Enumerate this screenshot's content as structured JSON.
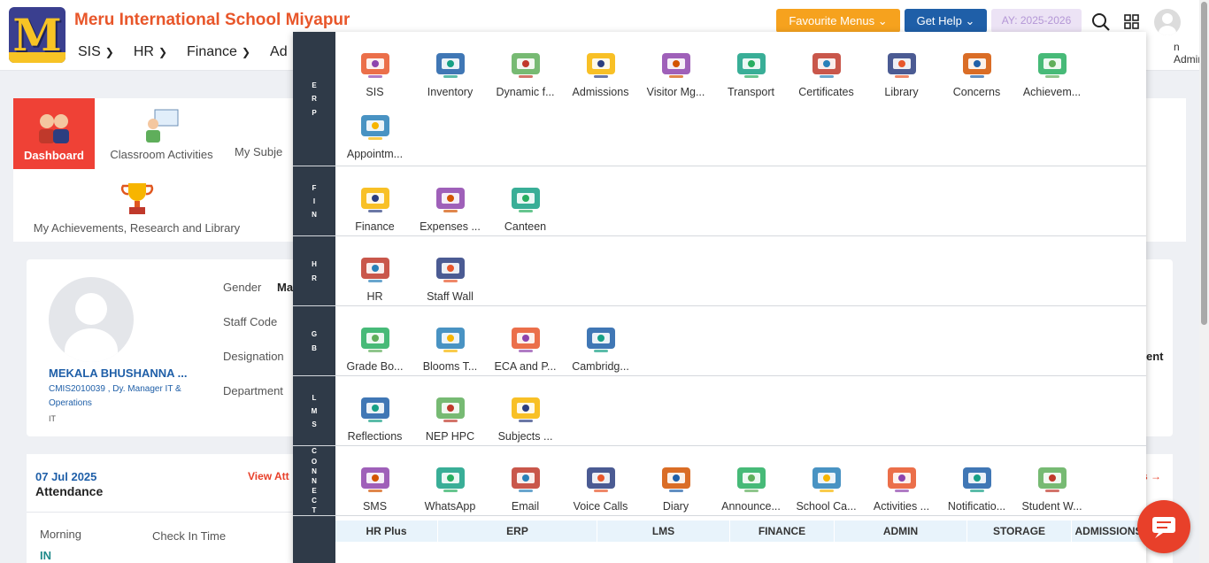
{
  "header": {
    "school_name": "Meru International School Miyapur",
    "logo_letter": "M",
    "nav": [
      "SIS",
      "HR",
      "Finance",
      "Ad"
    ],
    "favourite_menus": "Favourite Menus",
    "get_help": "Get Help",
    "academic_year": "AY: 2025-2026",
    "user_label": "n Admin"
  },
  "quick_links": {
    "dashboard": "Dashboard",
    "classroom": "Classroom Activities",
    "subjects": "My Subje",
    "achievements": "My Achievements, Research and Library"
  },
  "profile": {
    "name": "MEKALA BHUSHANNA ...",
    "code_line": "CMIS2010039 ,  Dy. Manager IT &",
    "code_line2": "Operations",
    "dept_short": "IT",
    "gender_label": "Gender",
    "gender_value": "Ma",
    "staff_code_label": "Staff Code",
    "designation_label": "Designation",
    "department_label": "Department",
    "right_fragment": "ent"
  },
  "attendance": {
    "date": "07 Jul 2025",
    "title": "Attendance",
    "view": "View Att",
    "morning": "Morning",
    "checkin": "Check In Time",
    "status": "IN",
    "arrow_fragment": "s →"
  },
  "menu": {
    "sections": [
      {
        "key": "erp",
        "label": [
          "E",
          "R",
          "P"
        ],
        "items": [
          "SIS",
          "Inventory",
          "Dynamic f...",
          "Admissions",
          "Visitor Mg...",
          "Transport",
          "Certificates",
          "Library",
          "Concerns",
          "Achievem...",
          "Appointm..."
        ]
      },
      {
        "key": "fin",
        "label": [
          "F",
          "I",
          "N"
        ],
        "items": [
          "Finance",
          "Expenses ...",
          "Canteen"
        ]
      },
      {
        "key": "hr",
        "label": [
          "H",
          "R"
        ],
        "items": [
          "HR",
          "Staff Wall"
        ]
      },
      {
        "key": "gb",
        "label": [
          "G",
          "B"
        ],
        "items": [
          "Grade Bo...",
          "Blooms T...",
          "ECA and P...",
          "Cambridg..."
        ]
      },
      {
        "key": "lms",
        "label": [
          "L",
          "M",
          "S"
        ],
        "items": [
          "Reflections",
          "NEP HPC",
          "Subjects ..."
        ]
      },
      {
        "key": "connect",
        "label": [
          "C",
          "O",
          "N",
          "N",
          "E",
          "C",
          "T"
        ],
        "items": [
          "SMS",
          "WhatsApp",
          "Email",
          "Voice Calls",
          "Diary",
          "Announce...",
          "School Ca...",
          "Activities ...",
          "Notificatio...",
          "Student W..."
        ]
      }
    ],
    "bottom_tabs": [
      "HR Plus",
      "ERP",
      "LMS",
      "FINANCE",
      "ADMIN",
      "STORAGE",
      "ADMISSIONS"
    ]
  },
  "colors": {
    "brand_orange": "#e8562a",
    "favourite": "#f6a21e",
    "help": "#1f5fa8",
    "sidebar": "#2f3a48",
    "link_red": "#e8402a",
    "name_blue": "#1f5fa8"
  }
}
